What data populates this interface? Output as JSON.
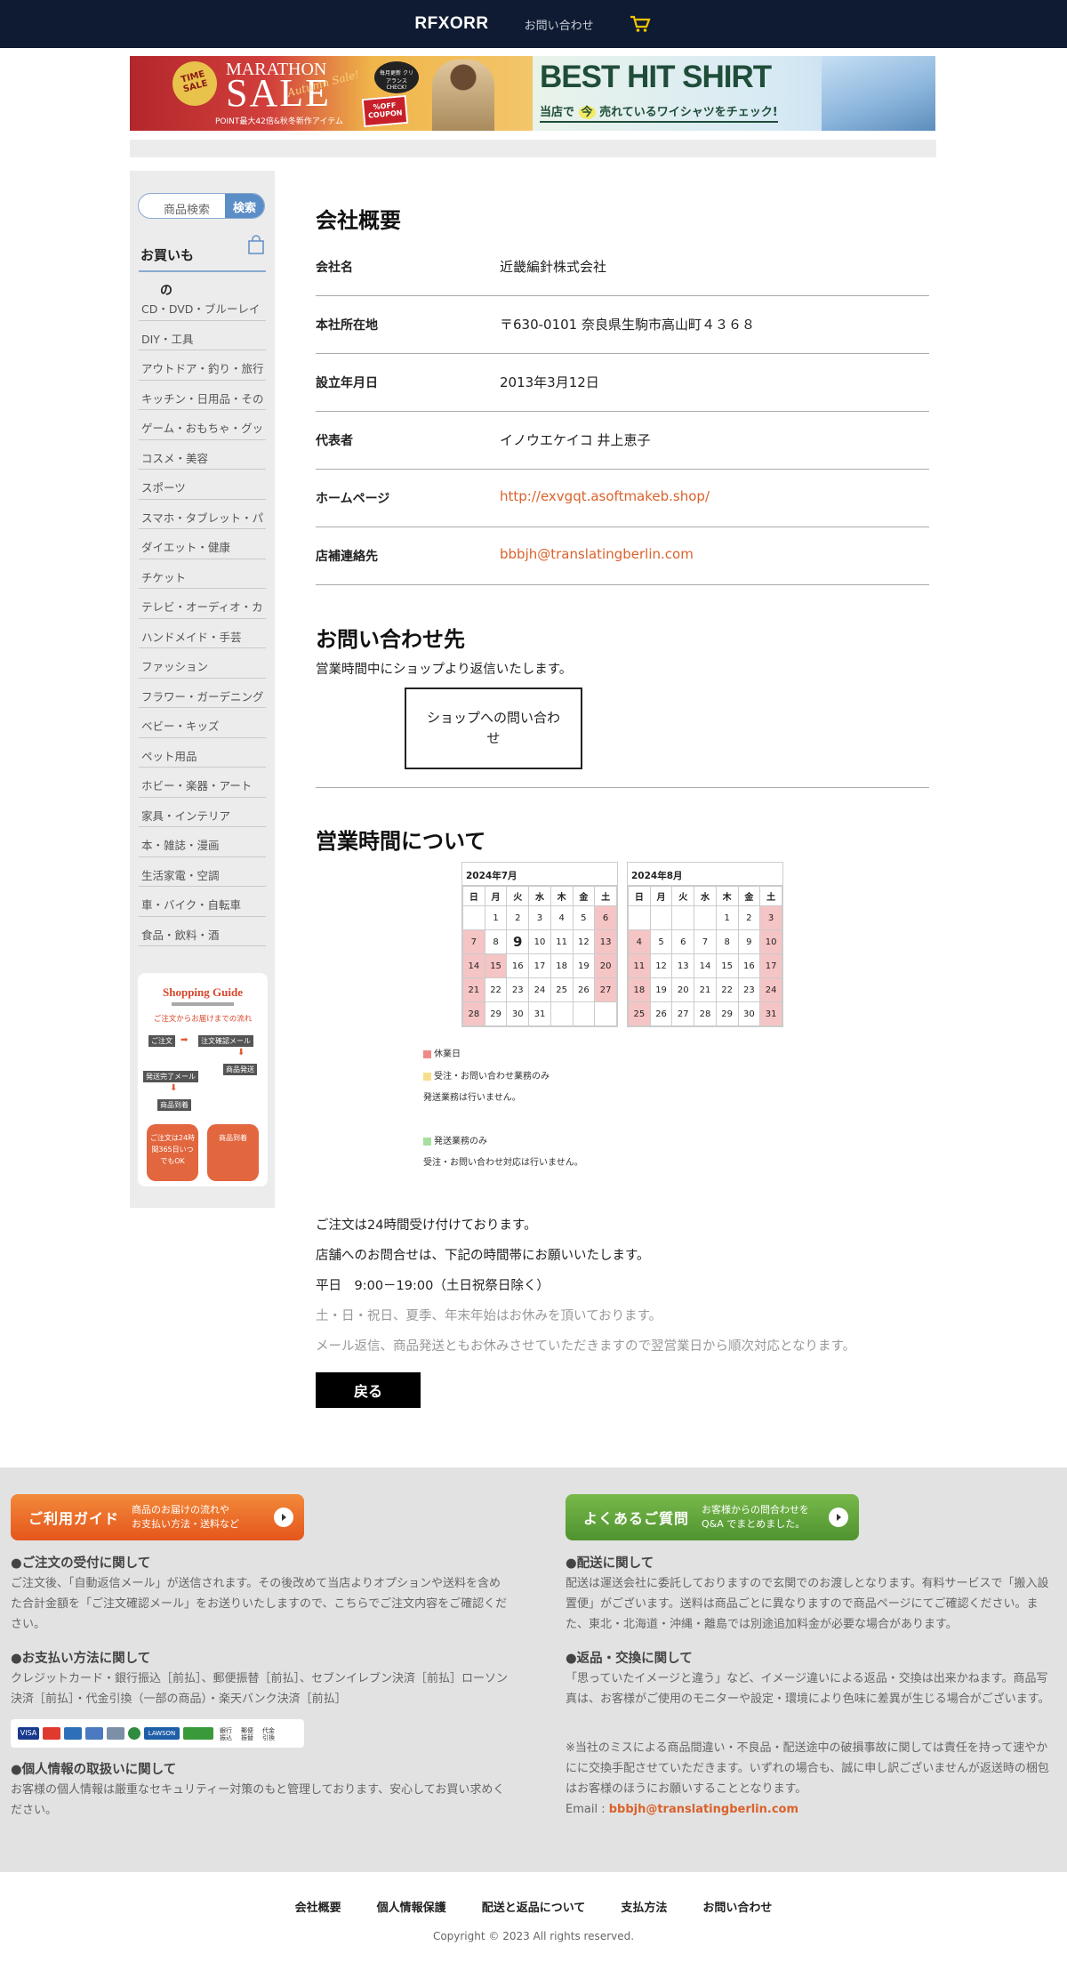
{
  "header": {
    "logo": "RFXORR",
    "contact_link": "お問い合わせ"
  },
  "banner_left": {
    "time_sale": "TIME SALE",
    "marathon": "MARATHON",
    "sale": "SALE",
    "autumn": "Autumn Sale!",
    "point": "POINT最大42倍&秋冬新作アイテム",
    "badge": "毎月更新 クリアランス CHECK!",
    "coupon": "%OFF COUPON"
  },
  "banner_right": {
    "headline": "BEST HIT SHIRT",
    "sub1": "当店で",
    "sub_now": "今",
    "sub2": "売れているワイシャツをチェック!"
  },
  "sidebar": {
    "search_placeholder": "商品検索",
    "search_button": "検索",
    "shop_title": "お買いも",
    "shop_title2": "の",
    "categories": [
      "CD・DVD・ブルーレイ",
      "DIY・工具",
      "アウトドア・釣り・旅行",
      "キッチン・日用品・その",
      "ゲーム・おもちゃ・グッ",
      "コスメ・美容",
      "スポーツ",
      "スマホ・タブレット・パ",
      "ダイエット・健康",
      "チケット",
      "テレビ・オーディオ・カ",
      "ハンドメイド・手芸",
      "ファッション",
      "フラワー・ガーデニング",
      "ベビー・キッズ",
      "ペット用品",
      "ホビー・楽器・アート",
      "家具・インテリア",
      "本・雑誌・漫画",
      "生活家電・空調",
      "車・バイク・自転車",
      "食品・飲料・酒"
    ],
    "guide": {
      "title": "Shopping Guide",
      "subtitle": "ご注文からお届けまでの流れ",
      "s1": "ご注文",
      "s2": "注文確認メール",
      "s3": "商品発送",
      "s4": "発送完了メール",
      "s5": "商品到着",
      "c1": "ご注文は24時間365日いつでもOK",
      "c2": "商品到着"
    }
  },
  "company": {
    "title": "会社概要",
    "rows": [
      {
        "label": "会社名",
        "value": "近畿編針株式会社"
      },
      {
        "label": "本社所在地",
        "value": "〒630-0101 奈良県生駒市高山町４３６８"
      },
      {
        "label": "設立年月日",
        "value": "2013年3月12日"
      },
      {
        "label": "代表者",
        "value": "イノウエケイコ 井上恵子"
      },
      {
        "label": "ホームページ",
        "value": "http://exvgqt.asoftmakeb.shop/"
      },
      {
        "label": "店補連絡先",
        "value": "bbbjh@translatingberlin.com"
      }
    ]
  },
  "contact": {
    "title": "お問い合わせ先",
    "desc": "営業時間中にショップより返信いたします。",
    "button": "ショップへの問い合わせ"
  },
  "hours": {
    "title": "営業時間について",
    "weekdays": [
      "日",
      "月",
      "火",
      "水",
      "木",
      "金",
      "土"
    ],
    "calendars": [
      {
        "title": "2024年7月",
        "cells": [
          "",
          "1",
          "2",
          "3",
          "4",
          "5",
          "6",
          "7",
          "8",
          "9",
          "10",
          "11",
          "12",
          "13",
          "14",
          "15",
          "16",
          "17",
          "18",
          "19",
          "20",
          "21",
          "22",
          "23",
          "24",
          "25",
          "26",
          "27",
          "28",
          "29",
          "30",
          "31",
          "",
          "",
          ""
        ],
        "holidays": [
          "6",
          "7",
          "13",
          "14",
          "15",
          "20",
          "21",
          "27",
          "28"
        ],
        "today": "9"
      },
      {
        "title": "2024年8月",
        "cells": [
          "",
          "",
          "",
          "",
          "1",
          "2",
          "3",
          "4",
          "5",
          "6",
          "7",
          "8",
          "9",
          "10",
          "11",
          "12",
          "13",
          "14",
          "15",
          "16",
          "17",
          "18",
          "19",
          "20",
          "21",
          "22",
          "23",
          "24",
          "25",
          "26",
          "27",
          "28",
          "29",
          "30",
          "31"
        ],
        "holidays": [
          "3",
          "4",
          "10",
          "11",
          "17",
          "18",
          "24",
          "25",
          "31"
        ],
        "today": ""
      }
    ],
    "legend": {
      "holiday": "休業日",
      "order_only": "受注・お問い合わせ業務のみ",
      "order_note": "発送業務は行いません。",
      "ship_only": "発送業務のみ",
      "ship_note": "受注・お問い合わせ対応は行いません。"
    },
    "colors": {
      "holiday": "#f08a8a",
      "order_only": "#f6df8c",
      "ship_only": "#a8dfa0"
    },
    "lines": [
      "ご注文は24時間受け付けております。",
      "店舗へのお問合せは、下記の時間帯にお願いいたします。",
      "平日　9:00－19:00（土日祝祭日除く）"
    ],
    "gray_lines": [
      "土・日・祝日、夏季、年末年始はお休みを頂いております。",
      "メール返信、商品発送ともお休みさせていただきますので翌営業日から順次対応となります。"
    ],
    "back": "戻る"
  },
  "footer": {
    "guide_btn": {
      "big": "ご利用ガイド",
      "small1": "商品のお届けの流れや",
      "small2": "お支払い方法・送料など"
    },
    "faq_btn": {
      "big": "よくあるご質問",
      "small1": "お客様からの問合わせを",
      "small2": "Q&A でまとめました。"
    },
    "order_h": "●ご注文の受付に関して",
    "order_p": "ご注文後、「自動返信メール」が送信されます。その後改めて当店よりオプションや送料を含めた合計金額を「ご注文確認メール」をお送りいたしますので、こちらでご注文内容をご確認ください。",
    "pay_h": "●お支払い方法に関して",
    "pay_p": "クレジットカード・銀行振込［前払］、郵便振替［前払］、セブンイレブン決済［前払］ローソン決済［前払］・代金引換（一部の商品）・楽天バンク決済［前払］",
    "pay_logos": {
      "visa": "VISA",
      "lawson": "LAWSON",
      "bank": "銀行振込",
      "post": "郵便振替",
      "cod": "代金引換"
    },
    "privacy_h": "●個人情報の取扱いに関して",
    "privacy_p": "お客様の個人情報は厳重なセキュリティー対策のもと管理しております、安心してお買い求めください。",
    "ship_h": "●配送に関して",
    "ship_p": "配送は運送会社に委託しておりますので玄関でのお渡しとなります。有料サービスで「搬入設置便」がございます。送料は商品ごとに異なりますので商品ページにてご確認ください。また、東北・北海道・沖縄・離島では別途追加料金が必要な場合があります。",
    "return_h": "●返品・交換に関して",
    "return_p": "「思っていたイメージと違う」など、イメージ違いによる返品・交換は出来かねます。商品写真は、お客様がご使用のモニターや設定・環境により色味に差異が生じる場合がございます。",
    "note_p": "※当社のミスによる商品間違い・不良品・配送途中の破損事故に関しては責任を持って速やかにに交換手配させていただきます。いずれの場合も、誠に申し訳ございませんが返送時の梱包はお客様のほうにお願いすることとなります。",
    "email_label": "Email : ",
    "email": "bbbjh@translatingberlin.com"
  },
  "bottom_nav": [
    "会社概要",
    "個人情報保護",
    "配送と返品について",
    "支払方法",
    "お問い合わせ"
  ],
  "copyright": "Copyright © 2023 All rights reserved."
}
